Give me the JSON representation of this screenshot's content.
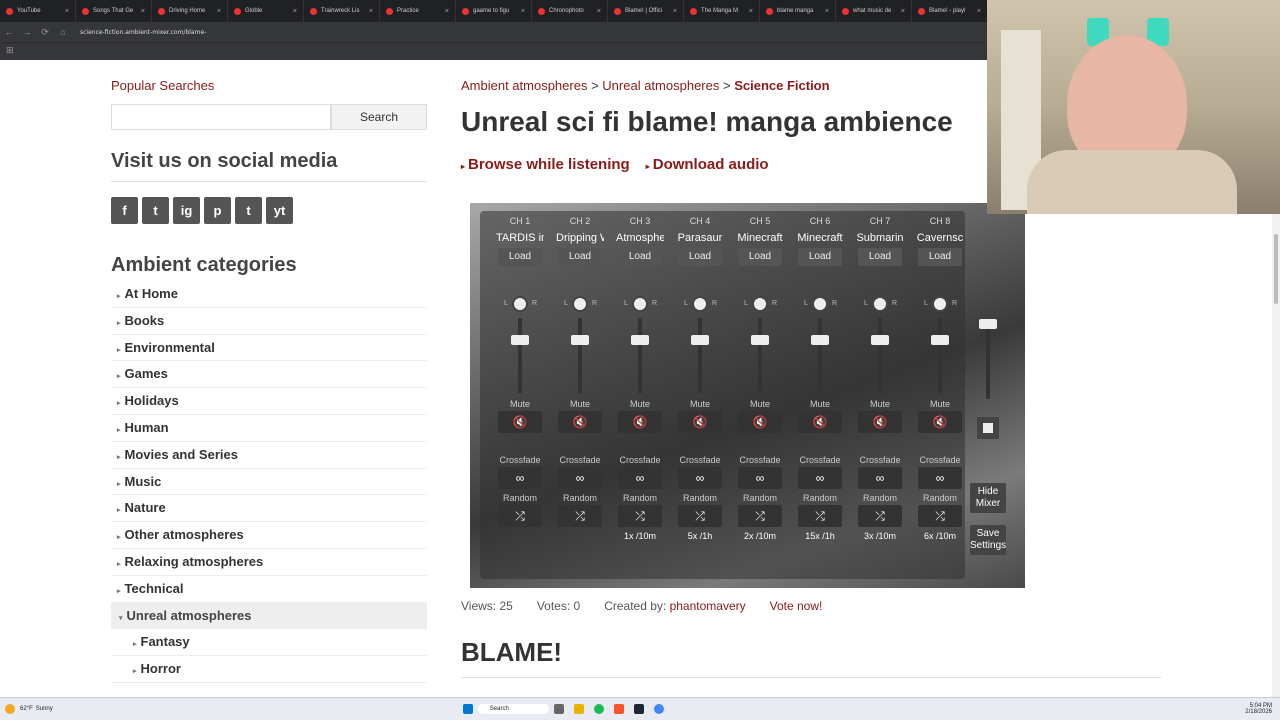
{
  "browser": {
    "tabs": [
      "YouTube",
      "Songs That Ge",
      "Driving Home",
      "Globle",
      "Trainwreck Lis",
      "Practice",
      "gaame to figu",
      "Chronophoto",
      "Blame! | Offici",
      "The Manga M",
      "blame manga",
      "what music de",
      "Blame! - playl"
    ],
    "url": "science-fiction.ambient-mixer.com/blame-"
  },
  "sidebar": {
    "popular_searches": "Popular Searches",
    "search_placeholder": "",
    "search_button": "Search",
    "social_heading": "Visit us on social media",
    "social_icons": [
      "f",
      "t",
      "ig",
      "p",
      "t",
      "yt"
    ],
    "categories_heading": "Ambient categories",
    "categories": [
      "At Home",
      "Books",
      "Environmental",
      "Games",
      "Holidays",
      "Human",
      "Movies and Series",
      "Music",
      "Nature",
      "Other atmospheres",
      "Relaxing atmospheres",
      "Technical",
      "Unreal atmospheres",
      "Fantasy",
      "Horror"
    ]
  },
  "main": {
    "breadcrumb": [
      "Ambient atmospheres",
      "Unreal atmospheres",
      "Science Fiction"
    ],
    "breadcrumb_sep": ">",
    "title": "Unreal sci fi blame! manga ambience",
    "browse_link": "Browse while listening",
    "download_link": "Download audio",
    "stats": {
      "views": "Views: 25",
      "votes": "Votes: 0",
      "created_label": "Created by:",
      "creator": "phantomavery",
      "vote_now": "Vote now!"
    },
    "section_heading": "BLAME!"
  },
  "mixer": {
    "channels": [
      {
        "num": "CH 1",
        "name": "TARDIS in",
        "rate": "",
        "vol": 0.78
      },
      {
        "num": "CH 2",
        "name": "Dripping W",
        "rate": "",
        "vol": 0.78
      },
      {
        "num": "CH 3",
        "name": "Atmosphere",
        "rate": "1x /10m",
        "vol": 0.78
      },
      {
        "num": "CH 4",
        "name": "Parasaur",
        "rate": "5x /1h",
        "vol": 0.78
      },
      {
        "num": "CH 5",
        "name": "Minecraft",
        "rate": "2x /10m",
        "vol": 0.78
      },
      {
        "num": "CH 6",
        "name": "Minecraft",
        "rate": "15x /1h",
        "vol": 0.78
      },
      {
        "num": "CH 7",
        "name": "Submarin",
        "rate": "3x /10m",
        "vol": 0.78
      },
      {
        "num": "CH 8",
        "name": "Cavernsc",
        "rate": "6x /10m",
        "vol": 0.78
      }
    ],
    "load": "Load",
    "mute": "Mute",
    "crossfade": "Crossfade",
    "random": "Random",
    "hide_mixer": "Hide Mixer",
    "save_settings": "Save Settings",
    "lr_l": "L",
    "lr_r": "R"
  },
  "taskbar": {
    "weather_temp": "62°F",
    "weather_desc": "Sunny",
    "search": "Search",
    "time": "5:04 PM",
    "date": "2/18/2026"
  }
}
